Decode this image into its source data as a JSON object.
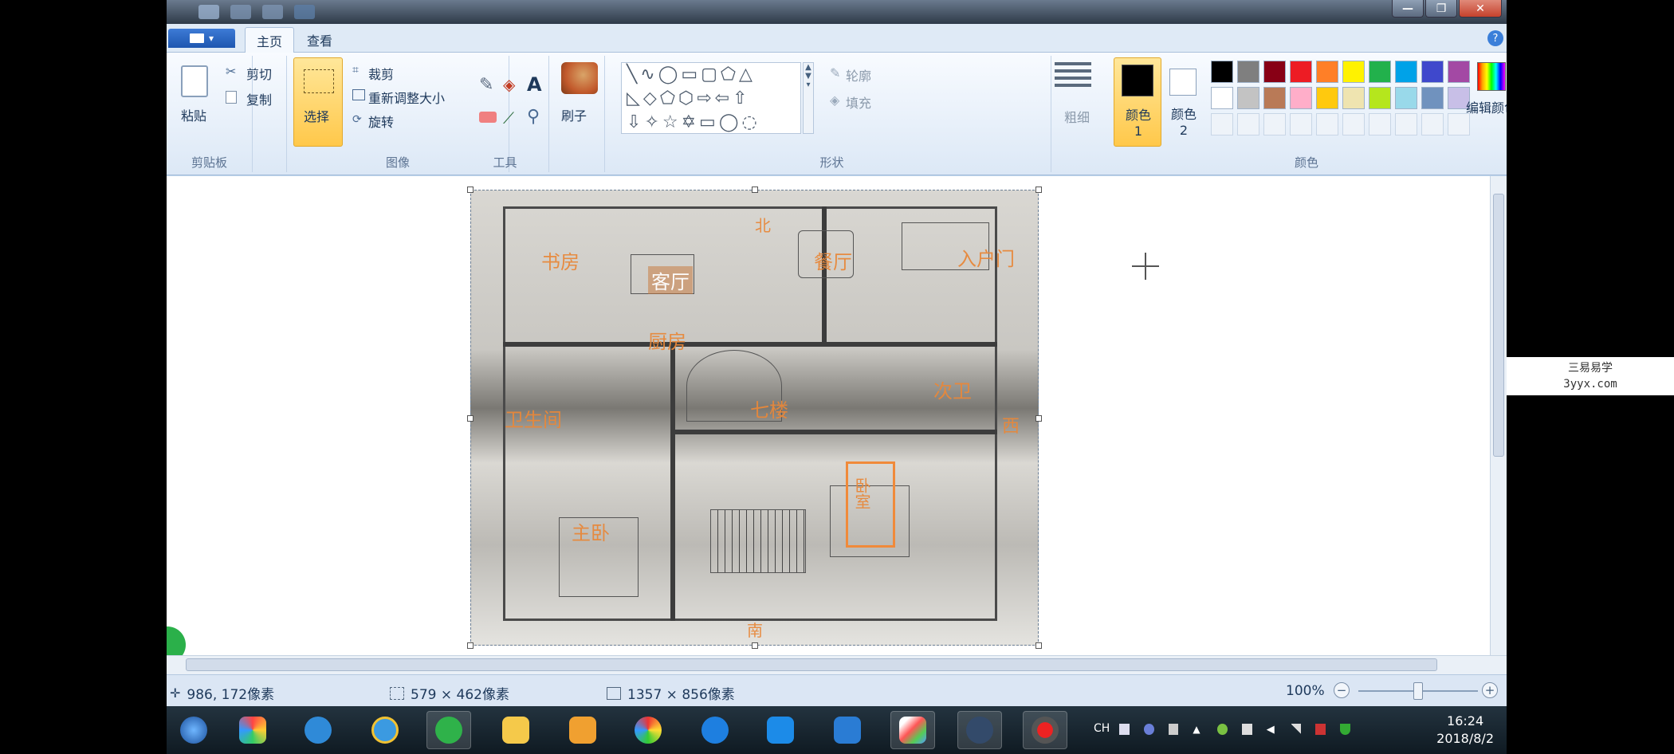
{
  "window": {
    "file_menu_label": "▾",
    "minimize": "—",
    "maximize": "❐",
    "close": "✕",
    "help": "?"
  },
  "tabs": [
    {
      "label": "主页",
      "active": true
    },
    {
      "label": "查看",
      "active": false
    }
  ],
  "ribbon": {
    "clipboard": {
      "label": "剪贴板",
      "paste": "粘贴",
      "cut": "剪切",
      "copy": "复制"
    },
    "image": {
      "label": "图像",
      "select": "选择",
      "crop": "裁剪",
      "resize": "重新调整大小",
      "rotate": "旋转"
    },
    "tools": {
      "label": "工具"
    },
    "brushes": {
      "label": "刷子"
    },
    "shapes": {
      "label": "形状",
      "outline": "轮廓",
      "fill": "填充"
    },
    "size": {
      "label": "粗细"
    },
    "colors": {
      "label": "颜色",
      "color1": "颜色 1",
      "color2": "颜色 2",
      "edit": "编辑颜色",
      "color1_value": "#000000",
      "color2_value": "#ffffff",
      "palette_row1": [
        "#000000",
        "#7f7f7f",
        "#880015",
        "#ed1c24",
        "#ff7f27",
        "#fff200",
        "#22b14c",
        "#00a2e8",
        "#3f48cc",
        "#a349a4"
      ],
      "palette_row2": [
        "#ffffff",
        "#c3c3c3",
        "#b97a57",
        "#ffaec9",
        "#ffc90e",
        "#efe4b0",
        "#b5e61d",
        "#99d9ea",
        "#7092be",
        "#c8bfe7"
      ]
    }
  },
  "floorplan": {
    "rooms": [
      "书房",
      "客厅",
      "餐厅",
      "入户门",
      "厨房",
      "卫生间",
      "主卧",
      "七楼",
      "次卫",
      "西",
      "卧室",
      "南",
      "北"
    ]
  },
  "status": {
    "cursor_pos": "986, 172像素",
    "selection_size": "579 × 462像素",
    "image_size": "1357 × 856像素",
    "zoom": "100%"
  },
  "taskbar": {
    "tray_lang": "CH",
    "time": "16:24",
    "date": "2018/8/2"
  },
  "watermark": {
    "line1": "三易易学",
    "line2": "3yyx.com"
  }
}
